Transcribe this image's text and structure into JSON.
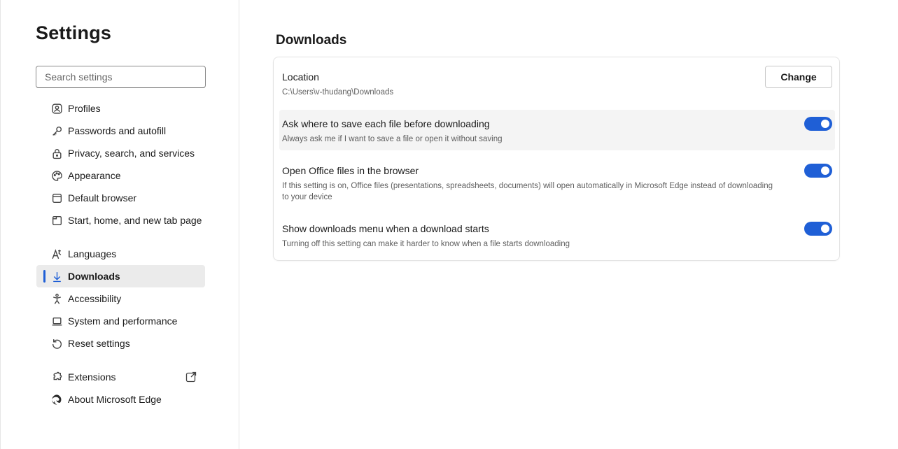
{
  "sidebar": {
    "title": "Settings",
    "search_placeholder": "Search settings",
    "items": [
      {
        "label": "Profiles",
        "icon": "profile-icon"
      },
      {
        "label": "Passwords and autofill",
        "icon": "key-icon"
      },
      {
        "label": "Privacy, search, and services",
        "icon": "lock-icon"
      },
      {
        "label": "Appearance",
        "icon": "palette-icon"
      },
      {
        "label": "Default browser",
        "icon": "browser-icon"
      },
      {
        "label": "Start, home, and new tab page",
        "icon": "home-tab-icon"
      },
      {
        "label": "Languages",
        "icon": "language-icon"
      },
      {
        "label": "Downloads",
        "icon": "download-icon",
        "active": true
      },
      {
        "label": "Accessibility",
        "icon": "accessibility-icon"
      },
      {
        "label": "System and performance",
        "icon": "laptop-icon"
      },
      {
        "label": "Reset settings",
        "icon": "reset-icon"
      },
      {
        "label": "Extensions",
        "icon": "puzzle-icon"
      },
      {
        "label": "About Microsoft Edge",
        "icon": "edge-logo-icon"
      }
    ]
  },
  "main": {
    "section_title": "Downloads",
    "location": {
      "title": "Location",
      "path": "C:\\Users\\v-thudang\\Downloads",
      "button_label": "Change"
    },
    "settings": [
      {
        "title": "Ask where to save each file before downloading",
        "description": "Always ask me if I want to save a file or open it without saving",
        "enabled": true
      },
      {
        "title": "Open Office files in the browser",
        "description": "If this setting is on, Office files (presentations, spreadsheets, documents) will open automatically in Microsoft Edge instead of downloading",
        "description_line2": "to your device",
        "enabled": true
      },
      {
        "title": "Show downloads menu when a download starts",
        "description": "Turning off this setting can make it harder to know when a file starts downloading",
        "enabled": true
      }
    ]
  },
  "colors": {
    "accent": "#1f5fd6",
    "active_nav_bg": "#ebebeb",
    "hover_row_bg": "#f4f4f4"
  }
}
